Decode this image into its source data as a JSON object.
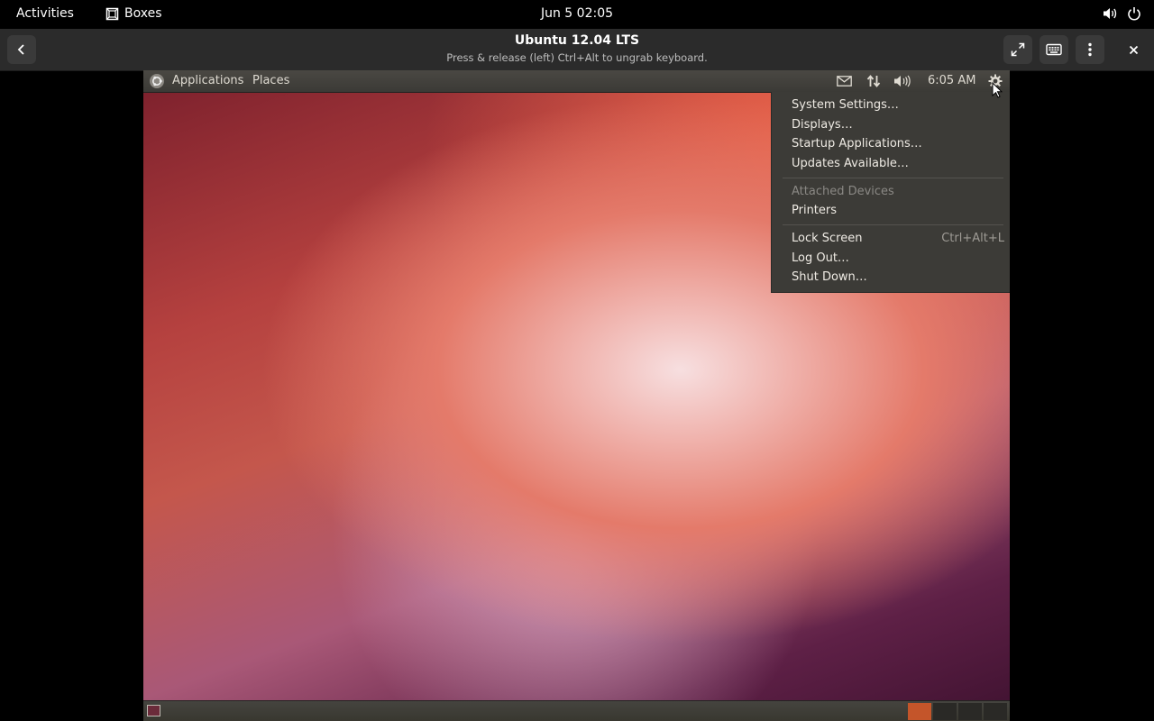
{
  "topbar": {
    "activities": "Activities",
    "app_name": "Boxes",
    "clock": "Jun 5  02:05"
  },
  "header": {
    "title": "Ubuntu 12.04 LTS",
    "subtitle": "Press & release (left) Ctrl+Alt to ungrab keyboard."
  },
  "vm": {
    "panel": {
      "applications": "Applications",
      "places": "Places",
      "time": "6:05 AM"
    },
    "menu": {
      "items": [
        "System Settings…",
        "Displays…",
        "Startup Applications…",
        "Updates Available…"
      ],
      "section_label": "Attached Devices",
      "printers": "Printers",
      "lock_screen": "Lock Screen",
      "lock_accel": "Ctrl+Alt+L",
      "log_out": "Log Out…",
      "shut_down": "Shut Down…"
    },
    "workspaces": {
      "active_color": "#c4552a",
      "inactive_color": "#2a2926"
    }
  },
  "colors": {
    "gnome_topbar": "#000000",
    "header_bg": "#2b2b2b",
    "ubuntu_panel": "#3c3b37"
  }
}
